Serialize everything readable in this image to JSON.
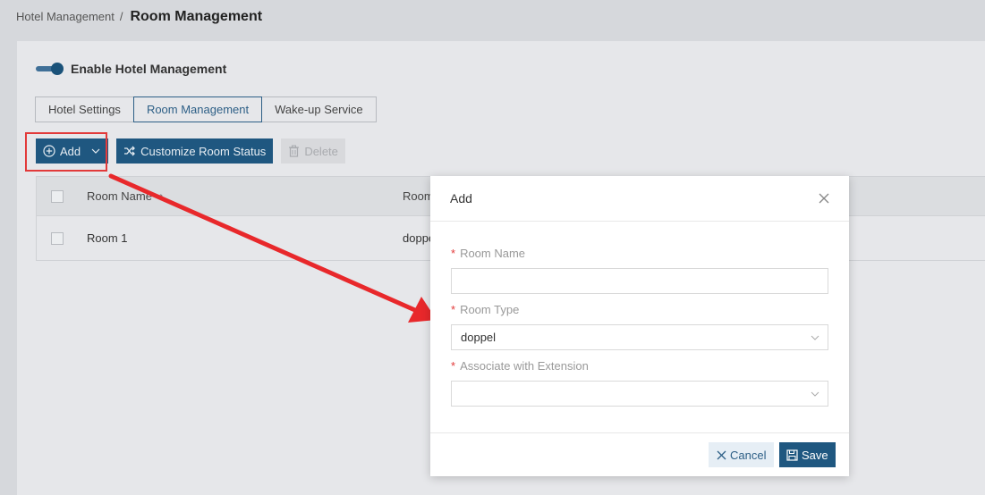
{
  "breadcrumb": {
    "parent": "Hotel Management",
    "separator": "/",
    "current": "Room Management"
  },
  "settings": {
    "enable_label": "Enable Hotel Management",
    "enabled": true
  },
  "tabs": [
    {
      "label": "Hotel Settings",
      "active": false
    },
    {
      "label": "Room Management",
      "active": true
    },
    {
      "label": "Wake-up Service",
      "active": false
    }
  ],
  "toolbar": {
    "add_label": "Add",
    "customize_label": "Customize Room Status",
    "delete_label": "Delete"
  },
  "table": {
    "columns": [
      "Room Name",
      "Room"
    ],
    "rows": [
      {
        "name": "Room 1",
        "type": "doppe"
      }
    ]
  },
  "modal": {
    "title": "Add",
    "fields": {
      "room_name": {
        "label": "Room Name",
        "value": ""
      },
      "room_type": {
        "label": "Room Type",
        "value": "doppel"
      },
      "extension": {
        "label": "Associate with Extension",
        "value": ""
      }
    },
    "cancel_label": "Cancel",
    "save_label": "Save"
  },
  "colors": {
    "primary": "#1f5780",
    "annotation": "#e23a3a"
  }
}
